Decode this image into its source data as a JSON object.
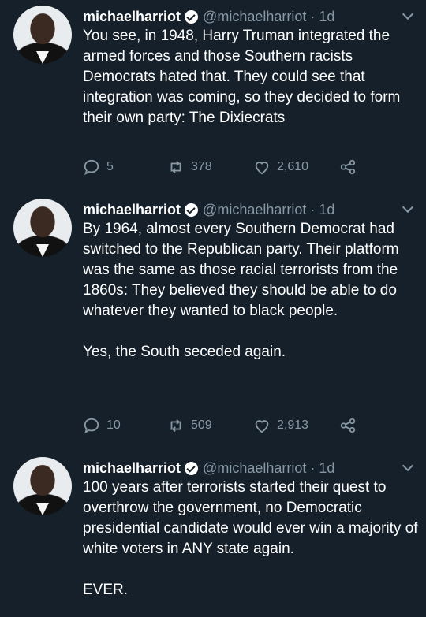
{
  "tweets": [
    {
      "name": "michaelharriot",
      "handle": "@michaelharriot · 1d",
      "text": "You see, in 1948, Harry Truman integrated the armed forces and those Southern racists Democrats hated that. They could see that integration was coming, so they decided to form their own party: The Dixiecrats",
      "replies": "5",
      "retweets": "378",
      "likes": "2,610"
    },
    {
      "name": "michaelharriot",
      "handle": "@michaelharriot · 1d",
      "text": "By 1964, almost every Southern Democrat had switched to the Republican party. Their platform was the same as those racial terrorists from the 1860s: They believed they should be able to do whatever they wanted to black people.\n\nYes, the South seceded again.",
      "replies": "10",
      "retweets": "509",
      "likes": "2,913"
    },
    {
      "name": "michaelharriot",
      "handle": "@michaelharriot · 1d",
      "text": "100 years after terrorists started their quest to overthrow the government, no Democratic presidential candidate would ever win a majority of white voters in ANY state again.\n\nEVER."
    }
  ]
}
